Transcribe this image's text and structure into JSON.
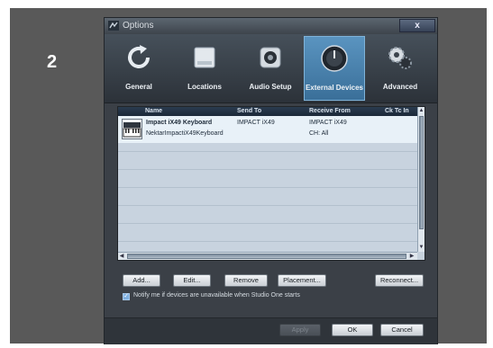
{
  "step_number": "2",
  "window": {
    "title": "Options",
    "close_glyph": "x"
  },
  "tabs": [
    {
      "label": "General",
      "icon": "general-icon"
    },
    {
      "label": "Locations",
      "icon": "locations-icon"
    },
    {
      "label": "Audio Setup",
      "icon": "audio-setup-icon"
    },
    {
      "label": "External Devices",
      "icon": "external-devices-icon",
      "active": true
    },
    {
      "label": "Advanced",
      "icon": "advanced-icon"
    }
  ],
  "device_table": {
    "columns": [
      "Name",
      "Send To",
      "Receive From",
      "Ck Tc In"
    ],
    "rows": [
      {
        "name": "Impact iX49 Keyboard",
        "model": "NektarImpactiX49Keyboard",
        "send_to": "IMPACT iX49",
        "receive_from": "IMPACT iX49",
        "receive_channel": "CH: All"
      }
    ]
  },
  "buttons": {
    "add": "Add...",
    "edit": "Edit...",
    "remove": "Remove",
    "placement": "Placement...",
    "reconnect": "Reconnect..."
  },
  "notify": {
    "checked": true,
    "label": "Notify me if devices are unavailable when Studio One starts"
  },
  "footer": {
    "apply": "Apply",
    "ok": "OK",
    "cancel": "Cancel"
  },
  "colors": {
    "slide_bg": "#595959",
    "active_tab": "#4a84b0",
    "selected_row": "#e8f1f8"
  }
}
